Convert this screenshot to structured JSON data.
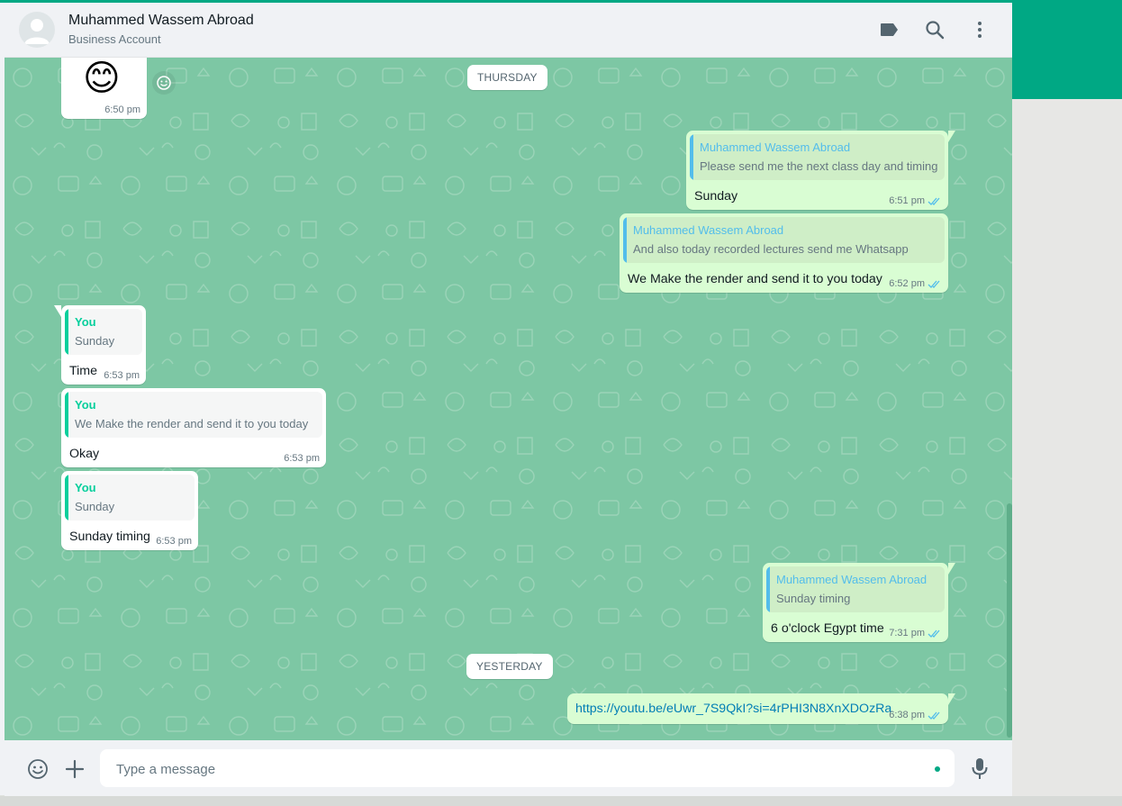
{
  "header": {
    "contact_name": "Muhammed Wassem Abroad",
    "contact_subtitle": "Business Account",
    "icons": [
      "label-icon",
      "search-icon",
      "menu-icon"
    ]
  },
  "chat": {
    "date_thursday": "THURSDAY",
    "date_yesterday": "YESTERDAY",
    "emoji_message": {
      "emoji": "😊",
      "time": "6:50 pm"
    },
    "messages": [
      {
        "direction": "out",
        "quote_name": "Muhammed Wassem Abroad",
        "quote_text": "Please send me the next class day and timing",
        "text": "Sunday",
        "time": "6:51 pm"
      },
      {
        "direction": "out",
        "quote_name": "Muhammed Wassem Abroad",
        "quote_text": "And also today recorded lectures send me Whatsapp",
        "text": "We Make the render and send it to you today",
        "time": "6:52 pm"
      },
      {
        "direction": "in",
        "quote_name": "You",
        "quote_text": "Sunday",
        "text": "Time",
        "time": "6:53 pm"
      },
      {
        "direction": "in",
        "quote_name": "You",
        "quote_text": "We Make the render and send it to you today",
        "text": "Okay",
        "time": "6:53 pm"
      },
      {
        "direction": "in",
        "quote_name": "You",
        "quote_text": "Sunday",
        "text": "Sunday timing",
        "time": "6:53 pm"
      },
      {
        "direction": "out",
        "quote_name": "Muhammed Wassem Abroad",
        "quote_text": "Sunday timing",
        "text": "6 o'clock Egypt time",
        "time": "7:31 pm"
      },
      {
        "direction": "out",
        "text": "https://youtu.be/eUwr_7S9QkI?si=4rPHI3N8XnXDOzRa",
        "time": "6:38 pm"
      }
    ]
  },
  "composer": {
    "placeholder": "Type a message",
    "value": ""
  },
  "colors": {
    "accent": "#00a884",
    "chat_background": "#7dc7a4",
    "outgoing_bubble": "#d9fdd3",
    "incoming_bubble": "#ffffff",
    "read_ticks": "#53bdeb"
  }
}
